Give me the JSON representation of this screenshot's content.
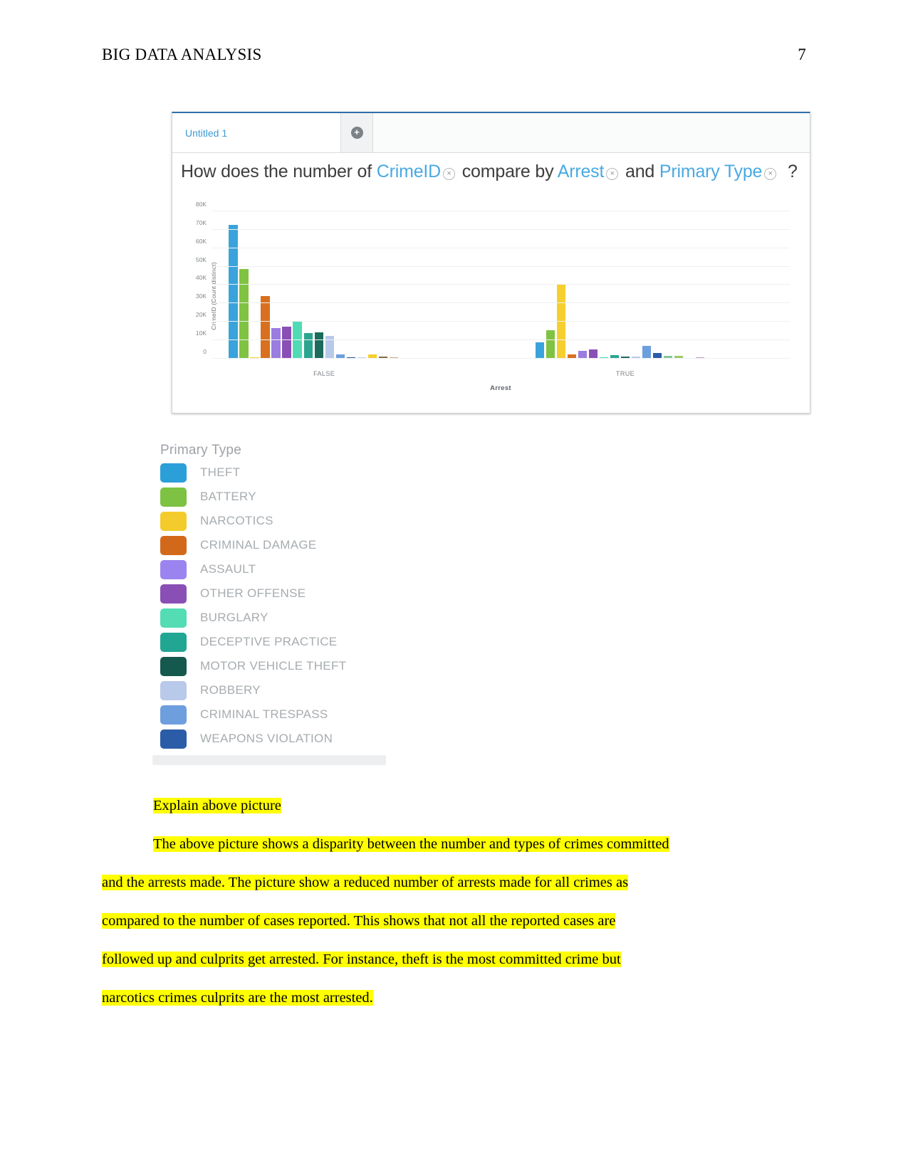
{
  "document": {
    "header_title": "BIG DATA ANALYSIS",
    "page_number": "7"
  },
  "app": {
    "tab_label": "Untitled 1",
    "add_tab_icon": "plus-circle-icon",
    "question": {
      "prefix": "How does the number of",
      "field1": "CrimeID",
      "middle": "compare by",
      "field2": "Arrest",
      "conjunction": "and",
      "field3": "Primary Type",
      "suffix": "?",
      "remove_icon": "circle-x-icon"
    }
  },
  "chart_data": {
    "type": "bar",
    "title": "",
    "xlabel": "Arrest",
    "ylabel": "CrimeID (Count distinct)",
    "ylim": [
      0,
      85000
    ],
    "yticks": [
      "0",
      "10K",
      "20K",
      "30K",
      "40K",
      "50K",
      "60K",
      "70K",
      "80K"
    ],
    "ytick_values": [
      0,
      10000,
      20000,
      30000,
      40000,
      50000,
      60000,
      70000,
      80000
    ],
    "grid": true,
    "legend_title": "Primary Type",
    "legend_position": "below-chart",
    "categories": [
      "FALSE",
      "TRUE"
    ],
    "series": [
      {
        "name": "THEFT",
        "color": "#3ba3dc",
        "values": [
          72500,
          9000
        ]
      },
      {
        "name": "BATTERY",
        "color": "#80c342",
        "values": [
          48500,
          15500
        ]
      },
      {
        "name": "NARCOTICS",
        "color": "#f5cf2e",
        "values": [
          600,
          40000
        ]
      },
      {
        "name": "CRIMINAL DAMAGE",
        "color": "#d9701f",
        "values": [
          34000,
          2300
        ]
      },
      {
        "name": "ASSAULT",
        "color": "#9b7ce0",
        "values": [
          16500,
          4300
        ]
      },
      {
        "name": "OTHER OFFENSE",
        "color": "#8a4fb5",
        "values": [
          17200,
          5000
        ]
      },
      {
        "name": "BURGLARY",
        "color": "#4fdcb4",
        "values": [
          20000,
          900
        ]
      },
      {
        "name": "DECEPTIVE PRACTICE",
        "color": "#2ba58f",
        "values": [
          14000,
          2000
        ]
      },
      {
        "name": "MOTOR VEHICLE THEFT",
        "color": "#1c6b5c",
        "values": [
          14300,
          1000
        ]
      },
      {
        "name": "ROBBERY",
        "color": "#b9c9ea",
        "values": [
          12200,
          1300
        ]
      },
      {
        "name": "CRIMINAL TRESPASS",
        "color": "#6d9ede",
        "values": [
          2300,
          6800
        ]
      },
      {
        "name": "WEAPONS VIOLATION",
        "color": "#2a5ca8",
        "values": [
          900,
          3000
        ]
      }
    ],
    "trailing_small_bars_false": [
      {
        "color": "#c8d3e8",
        "value": 700
      },
      {
        "color": "#f5cf2e",
        "value": 2300
      },
      {
        "color": "#8a6a3c",
        "value": 1100
      },
      {
        "color": "#c4b08a",
        "value": 700
      },
      {
        "color": "#7fa8d8",
        "value": 400
      },
      {
        "color": "#9db6d8",
        "value": 400
      }
    ],
    "trailing_small_bars_true": [
      {
        "color": "#85c99a",
        "value": 1700
      },
      {
        "color": "#9fc96a",
        "value": 1500
      },
      {
        "color": "#d9b35c",
        "value": 500
      },
      {
        "color": "#c2a0c8",
        "value": 600
      },
      {
        "color": "#d98a9a",
        "value": 500
      }
    ]
  },
  "legend": {
    "title": "Primary Type",
    "items": [
      {
        "label": "THEFT",
        "color": "#2b9fd8"
      },
      {
        "label": "BATTERY",
        "color": "#7dc242"
      },
      {
        "label": "NARCOTICS",
        "color": "#f4cb2c"
      },
      {
        "label": "CRIMINAL DAMAGE",
        "color": "#d2691a"
      },
      {
        "label": "ASSAULT",
        "color": "#9b84ef"
      },
      {
        "label": "OTHER OFFENSE",
        "color": "#8a4fb5"
      },
      {
        "label": "BURGLARY",
        "color": "#54dcb4"
      },
      {
        "label": "DECEPTIVE PRACTICE",
        "color": "#21a694"
      },
      {
        "label": "MOTOR VEHICLE THEFT",
        "color": "#14584e"
      },
      {
        "label": "ROBBERY",
        "color": "#b9c9ea"
      },
      {
        "label": "CRIMINAL TRESPASS",
        "color": "#6d9ede"
      },
      {
        "label": "WEAPONS VIOLATION",
        "color": "#2a5ca8"
      }
    ]
  },
  "body": {
    "heading": "Explain above picture",
    "paragraph_lines": [
      "The above picture shows a disparity between the number and types of crimes committed",
      "and the arrests made. The picture show a reduced number of arrests made for all crimes as",
      "compared to the number of cases reported. This shows that not all the reported cases are",
      "followed up and culprits get arrested. For instance, theft is the most committed crime but",
      "narcotics crimes culprits are the most arrested."
    ]
  }
}
